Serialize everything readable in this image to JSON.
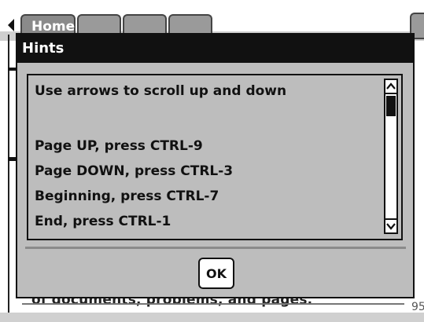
{
  "background": {
    "tabs": [
      {
        "label": "Home"
      },
      {
        "label": ""
      },
      {
        "label": ""
      },
      {
        "label": ""
      }
    ],
    "partial_text": "of documents, problems, and pages.",
    "right_edge_number": "95"
  },
  "dialog": {
    "title": "Hints",
    "lines": [
      "Use arrows to scroll up and down",
      "",
      "Page UP, press CTRL-9",
      "Page DOWN, press CTRL-3",
      "Beginning, press CTRL-7",
      "End, press CTRL-1"
    ],
    "ok_label": "OK",
    "scroll_position": 0.0
  },
  "icons": {
    "left_arrow": "left-arrow-icon",
    "scroll_up": "chevron-up-icon",
    "scroll_down": "chevron-down-icon"
  }
}
